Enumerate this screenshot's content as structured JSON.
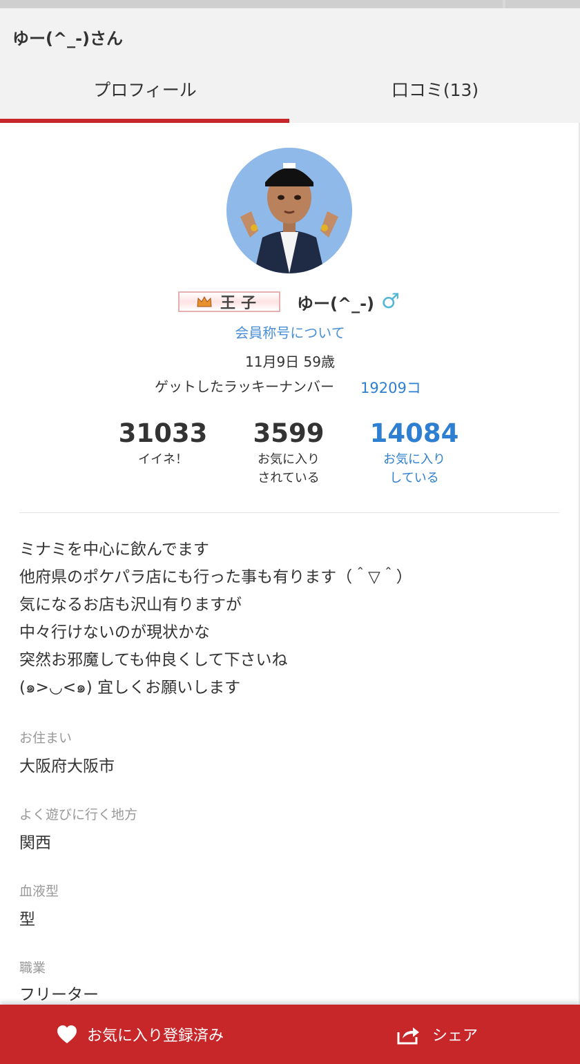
{
  "header": {
    "title": "ゆー(^_-)さん",
    "tabs": [
      {
        "label": "プロフィール",
        "active": true
      },
      {
        "label": "口コミ(13)",
        "active": false
      }
    ],
    "accent_color": "#c8272a"
  },
  "profile": {
    "title_badge": "王子",
    "name": "ゆー(^_-)",
    "gender_symbol": "♂",
    "title_link": "会員称号について",
    "birthday_age": "11月9日 59歳",
    "lucky_label": "ゲットしたラッキーナンバー",
    "lucky_value": "19209コ"
  },
  "stats": {
    "likes": {
      "value": "31033",
      "label": "イイネ！"
    },
    "favorited_by": {
      "value": "3599",
      "label1": "お気に入り",
      "label2": "されている"
    },
    "favoriting": {
      "value": "14084",
      "label1": "お気に入り",
      "label2": "している"
    }
  },
  "bio": [
    "ミナミを中心に飲んでます",
    "他府県のポケパラ店にも行った事も有ります（＾▽＾）",
    "気になるお店も沢山有りますが",
    "中々行けないのが現状かな",
    "突然お邪魔しても仲良くして下さいね",
    "(๑>◡<๑) 宜しくお願いします"
  ],
  "fields": [
    {
      "label": "お住まい",
      "value": "大阪府大阪市"
    },
    {
      "label": "よく遊びに行く地方",
      "value": "関西"
    },
    {
      "label": "血液型",
      "value": "型"
    },
    {
      "label": "職業",
      "value": "フリーター"
    }
  ],
  "bottom_bar": {
    "favorite_label": "お気に入り登録済み",
    "share_label": "シェア"
  }
}
